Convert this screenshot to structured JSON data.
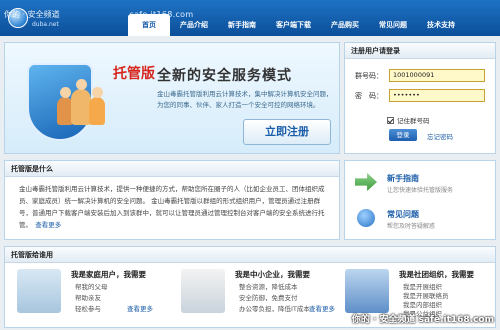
{
  "watermark": {
    "top_left": "你的 · 安全频道",
    "top_url": "safe.it168.com",
    "bottom_right": "你的 · 安全频道 safe.it168.com"
  },
  "logo": {
    "brand": "duba.net"
  },
  "nav": {
    "items": [
      "首页",
      "产品介绍",
      "新手指南",
      "客户端下载",
      "产品购买",
      "常见问题",
      "技术支持"
    ],
    "active_index": 0
  },
  "banner": {
    "edition": "托管版",
    "title": "全新的安全服务模式",
    "description": "金山毒霸托管版利用云计算技术，集中解决计算机安全问题，为您的同事、伙伴、家人打造一个安全可控的网络环境。",
    "register_label": "立即注册"
  },
  "login": {
    "heading": "注册用户请登录",
    "group_label": "群号码：",
    "group_value": "1001000091",
    "password_label": "密　码：",
    "password_value": "•••••••",
    "remember_label": "记住群号码",
    "login_label": "登录",
    "forgot_label": "忘记密码"
  },
  "info": {
    "heading": "托管版是什么",
    "body": "金山毒霸托管版利用云计算技术，提供一种便捷的方式，帮助您所在圈子的人（比如企业员工、团体组织成员、家庭成员）统一解决计算机的安全问题。 金山毒霸托管版以群组的形式组织用户，管理员通过注册群号，普通用户下载客户端安装后加入到该群中，就可以让管理员通过管理控制台对客户端的安全系统进行托管。",
    "more_label": "查看更多"
  },
  "guide": {
    "items": [
      {
        "title": "新手指南",
        "subtitle": "让您快速体验托管版服务"
      },
      {
        "title": "常见问题",
        "subtitle": "帮您及时答疑解惑"
      }
    ]
  },
  "audience": {
    "heading": "托管版给谁用",
    "cards": [
      {
        "title": "我是家庭用户，我需要",
        "lines": [
          "帮我的父母",
          "帮助亲友",
          "轻松参与"
        ],
        "more_label": "查看更多"
      },
      {
        "title": "我是中小企业，我需要",
        "lines": [
          "整合资源，降低成本",
          "安全防御，免费支付",
          "办公零负担，降低IT成本"
        ],
        "more_label": "查看更多"
      },
      {
        "title": "我是社团组织，我需要",
        "lines": [
          "我是开展组织",
          "我是开展联络员",
          "我是内部组织",
          "我是公益组织"
        ],
        "more_label": ""
      }
    ]
  },
  "colors": {
    "brand_blue": "#1a5da8",
    "nav_bar": "#1e73c4",
    "accent_red": "#d7261e"
  }
}
